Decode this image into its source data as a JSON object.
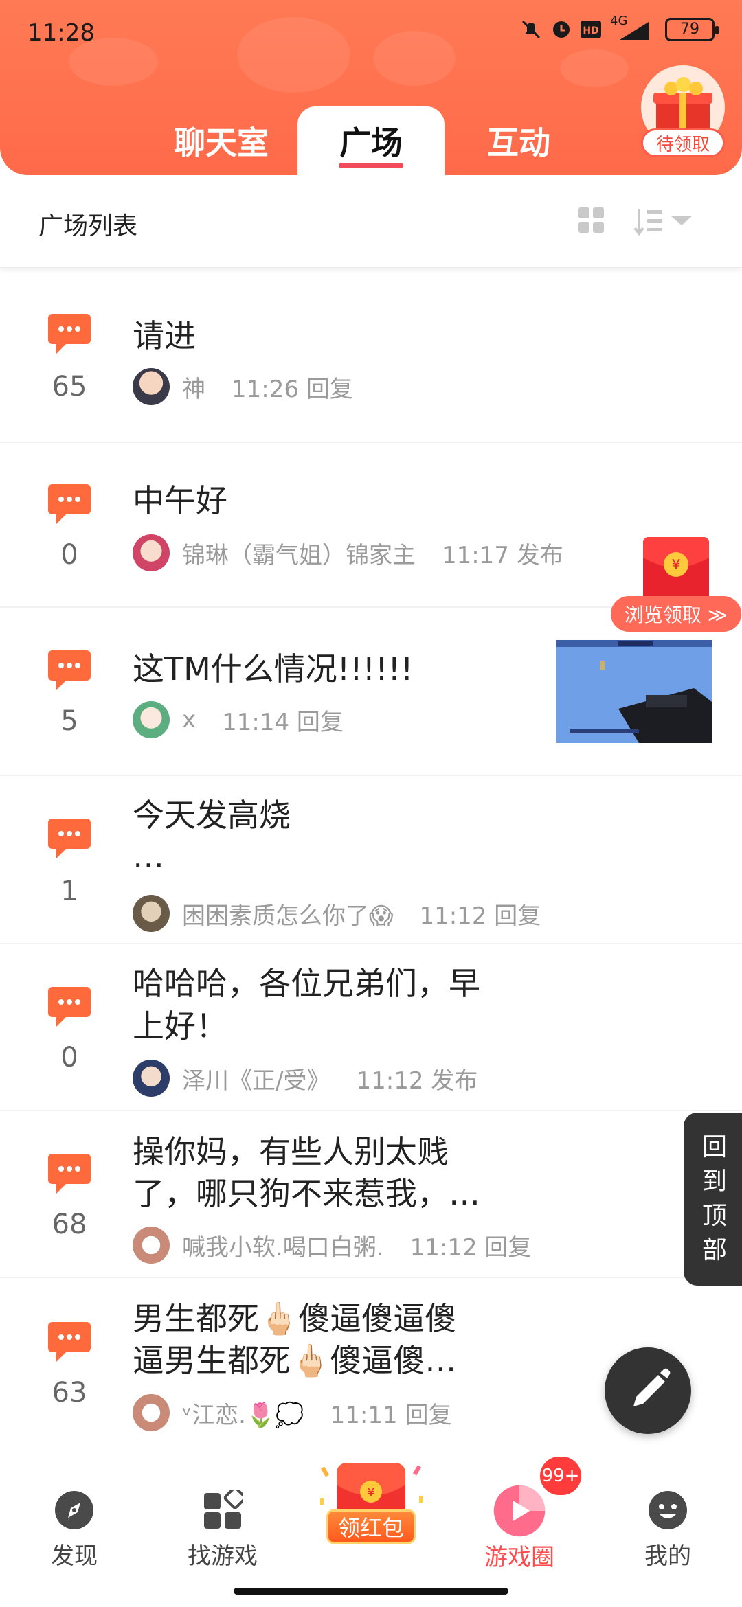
{
  "status": {
    "time": "11:28",
    "battery": "79",
    "network": "4G"
  },
  "tabs": [
    "聊天室",
    "广场",
    "互动"
  ],
  "gift_label": "待领取",
  "list_header": "广场列表",
  "posts": [
    {
      "count": "65",
      "title": "请进",
      "author": "神",
      "time": "11:26 回复"
    },
    {
      "count": "0",
      "title": "中午好",
      "author": "锦琳（霸气姐）锦家主",
      "time": "11:17 发布"
    },
    {
      "count": "5",
      "title": "这TM什么情况!!!!!!",
      "author": "x",
      "time": "11:14 回复"
    },
    {
      "count": "1",
      "title": "今天发高烧",
      "title2": "…",
      "author": "困困素质怎么你了😱",
      "time": "11:12 回复"
    },
    {
      "count": "0",
      "title": "哈哈哈，各位兄弟们，早",
      "title2": "上好！",
      "author": "泽川《正/受》",
      "time": "11:12 发布"
    },
    {
      "count": "68",
      "title": "操你妈，有些人别太贱",
      "title2": "了，哪只狗不来惹我，…",
      "author": "喊我小软.喝口白粥.",
      "time": "11:12 回复"
    },
    {
      "count": "63",
      "title": "男生都死🖕🏻傻逼傻逼傻",
      "title2": "逼男生都死🖕🏻傻逼傻…",
      "author": "ᵛ江恋.🌷💭",
      "time": "11:11 回复"
    }
  ],
  "browse_label": "浏览领取 ≫",
  "to_top": [
    "回",
    "到",
    "顶",
    "部"
  ],
  "nav": [
    "发现",
    "找游戏",
    "领红包",
    "游戏圈",
    "我的"
  ],
  "badge": "99+",
  "colors": {
    "accent": "#ff6a4a",
    "active_nav": "#ff4d4f"
  }
}
